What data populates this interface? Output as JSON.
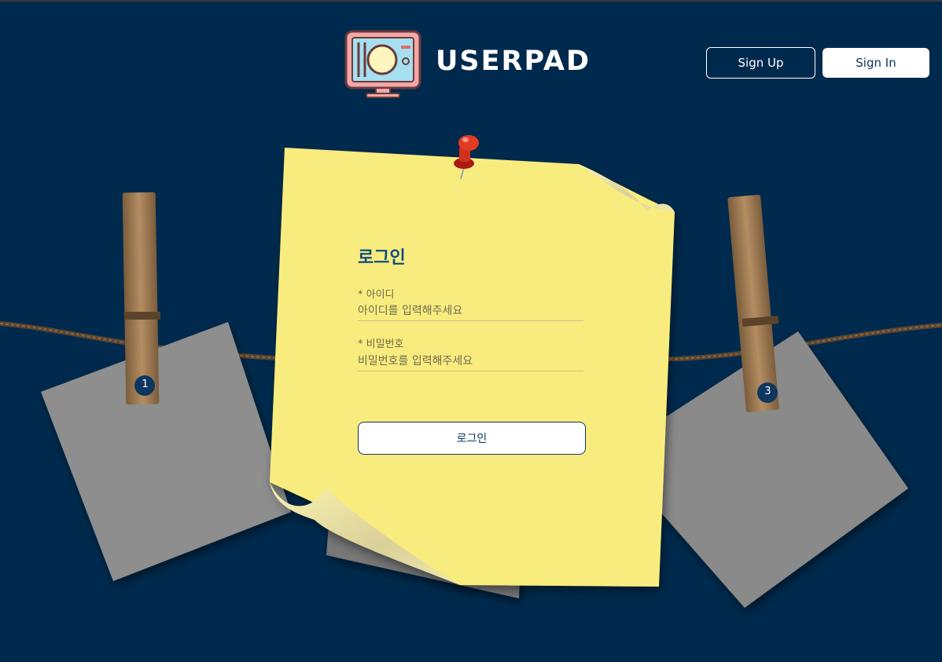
{
  "header": {
    "brand": "USERPAD",
    "signup_label": "Sign Up",
    "signin_label": "Sign In"
  },
  "login": {
    "title": "로그인",
    "id_label": "* 아이디",
    "id_placeholder": "아이디를 입력해주세요",
    "pw_label": "* 비밀번호",
    "pw_placeholder": "비밀번호를 입력해주세요",
    "submit_label": "로그인"
  },
  "decor": {
    "card_left_number": "1",
    "card_right_number": "3"
  },
  "colors": {
    "background": "#002a4d",
    "note": "#f9ec7e",
    "accent": "#0e3760",
    "title": "#0e4d84"
  }
}
